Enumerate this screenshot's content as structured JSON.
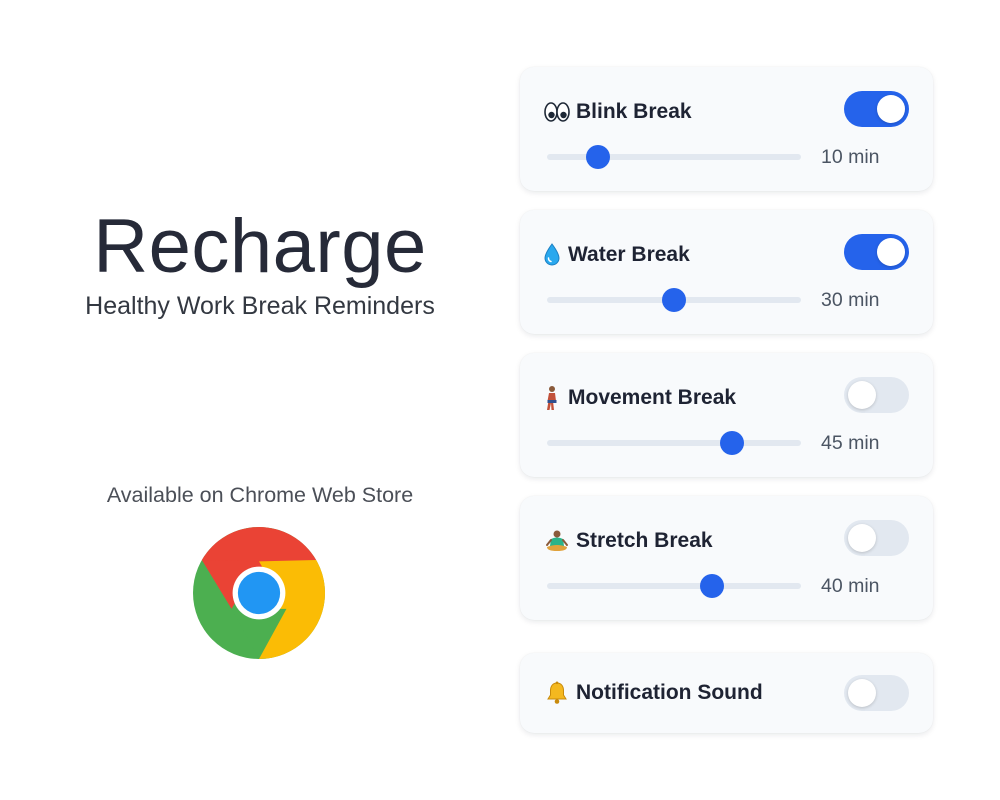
{
  "promo": {
    "title": "Recharge",
    "tagline": "Healthy Work Break Reminders",
    "store_label": "Available on Chrome Web Store",
    "logo_icon": "chrome-logo-icon"
  },
  "settings": {
    "breaks": [
      {
        "id": "blink",
        "icon": "eyes-icon",
        "label": "Blink Break",
        "enabled": true,
        "slider_fraction": 0.2,
        "duration": "10 min"
      },
      {
        "id": "water",
        "icon": "water-drop-icon",
        "label": "Water Break",
        "enabled": true,
        "slider_fraction": 0.5,
        "duration": "30 min"
      },
      {
        "id": "movement",
        "icon": "walking-person-icon",
        "label": "Movement Break",
        "enabled": false,
        "slider_fraction": 0.727,
        "duration": "45 min"
      },
      {
        "id": "stretch",
        "icon": "yoga-person-icon",
        "label": "Stretch Break",
        "enabled": false,
        "slider_fraction": 0.648,
        "duration": "40 min"
      }
    ],
    "notification_sound": {
      "icon": "bell-icon",
      "label": "Notification Sound",
      "enabled": false
    }
  },
  "colors": {
    "accent": "#2563eb",
    "toggle_off": "#e2e8f0",
    "card_bg": "#f8fafc",
    "chrome_red": "#ea4335",
    "chrome_yellow": "#fbbc05",
    "chrome_green": "#4caf50",
    "chrome_blue": "#2196f3"
  }
}
